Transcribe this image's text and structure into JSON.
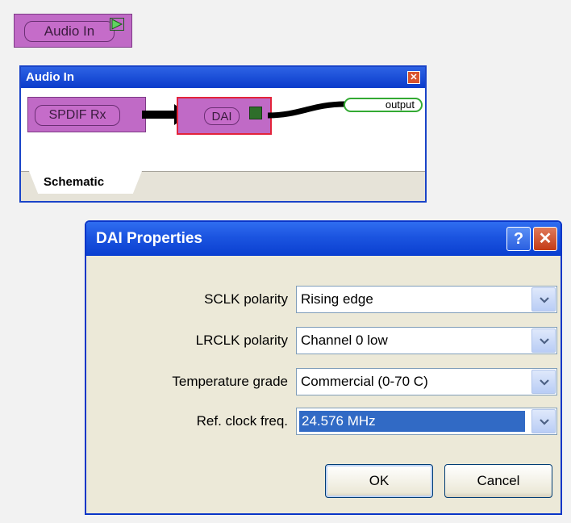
{
  "top_block": {
    "label": "Audio In"
  },
  "schematic_window": {
    "title": "Audio In",
    "blocks": {
      "spdif": "SPDIF Rx",
      "dai": "DAI",
      "output": "output"
    },
    "tab": "Schematic"
  },
  "dialog": {
    "title": "DAI Properties",
    "help_glyph": "?",
    "fields": [
      {
        "label": "SCLK polarity",
        "value": "Rising edge"
      },
      {
        "label": "LRCLK polarity",
        "value": "Channel 0 low"
      },
      {
        "label": "Temperature grade",
        "value": "Commercial (0-70 C)"
      },
      {
        "label": "Ref. clock freq.",
        "value": "24.576 MHz"
      }
    ],
    "ok_label": "OK",
    "cancel_label": "Cancel"
  },
  "colors": {
    "block_fill": "#c06ac6",
    "selection": "#316ac5",
    "title_bar": "#0a3fd0"
  }
}
